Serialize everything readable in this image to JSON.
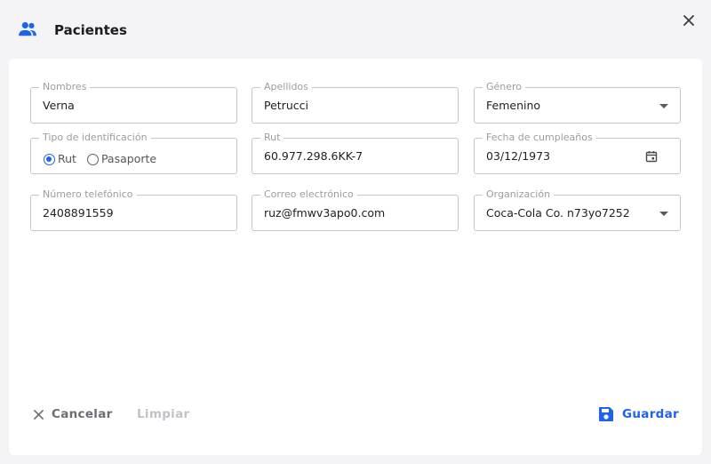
{
  "header": {
    "title": "Pacientes",
    "icon": "people-icon",
    "close_icon": "close-icon"
  },
  "form": {
    "nombres": {
      "label": "Nombres",
      "value": "Verna"
    },
    "apellidos": {
      "label": "Apellidos",
      "value": "Petrucci"
    },
    "genero": {
      "label": "Género",
      "value": "Femenino"
    },
    "tipo_identificacion": {
      "label": "Tipo de identificación",
      "options": [
        "Rut",
        "Pasaporte"
      ],
      "selected": "Rut"
    },
    "rut": {
      "label": "Rut",
      "value": "60.977.298.6KK-7"
    },
    "fecha_cumpleanos": {
      "label": "Fecha de cumpleaños",
      "value": "03/12/1973"
    },
    "telefono": {
      "label": "Número telefónico",
      "value": "2408891559"
    },
    "correo": {
      "label": "Correo electrónico",
      "value": "ruz@fmwv3apo0.com"
    },
    "organizacion": {
      "label": "Organización",
      "value": "Coca-Cola Co. n73yo7252"
    }
  },
  "actions": {
    "cancel_label": "Cancelar",
    "clear_label": "Limpiar",
    "save_label": "Guardar"
  },
  "colors": {
    "accent": "#1f63e6",
    "background": "#f4f4f6",
    "card": "#ffffff",
    "border": "#c6c6cc",
    "label": "#9c9ca4",
    "disabled": "#c2c2c8"
  }
}
